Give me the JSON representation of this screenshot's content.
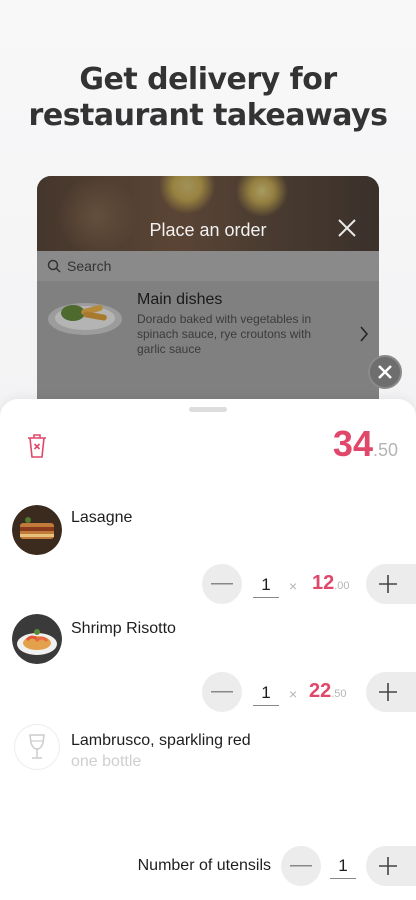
{
  "headline": {
    "line1": "Get delivery for",
    "line2": "restaurant takeaways"
  },
  "preview": {
    "title": "Place an order",
    "search_placeholder": "Search",
    "dish": {
      "name": "Main dishes",
      "description": "Dorado baked with vegetables in spinach sauce, rye croutons with garlic sauce"
    }
  },
  "cart": {
    "total_main": "34",
    "total_cents": ".50",
    "items": [
      {
        "name": "Lasagne",
        "qty": "1",
        "times": "×",
        "price_main": "12",
        "price_cents": ".00"
      },
      {
        "name": "Shrimp Risotto",
        "qty": "1",
        "times": "×",
        "price_main": "22",
        "price_cents": ".50"
      },
      {
        "name": "Lambrusco, sparkling red",
        "sub": "one bottle"
      }
    ],
    "utensils": {
      "label": "Number of utensils",
      "qty": "1"
    }
  },
  "colors": {
    "accent": "#e0476a",
    "muted": "#b5b5b5",
    "button_bg": "#ececec"
  },
  "icons": [
    "search-icon",
    "close-icon",
    "chevron-right-icon",
    "trash-icon",
    "minus-icon",
    "plus-icon",
    "wine-glass-icon"
  ]
}
